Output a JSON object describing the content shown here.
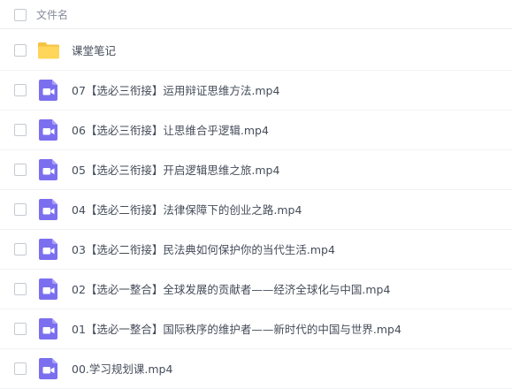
{
  "header": {
    "column_label": "文件名"
  },
  "files": [
    {
      "name": "课堂笔记",
      "type": "folder",
      "icon": "folder-icon"
    },
    {
      "name": "07【选必三衔接】运用辩证思维方法.mp4",
      "type": "video",
      "icon": "video-file-icon"
    },
    {
      "name": "06【选必三衔接】让思维合乎逻辑.mp4",
      "type": "video",
      "icon": "video-file-icon"
    },
    {
      "name": "05【选必三衔接】开启逻辑思维之旅.mp4",
      "type": "video",
      "icon": "video-file-icon"
    },
    {
      "name": "04【选必二衔接】法律保障下的创业之路.mp4",
      "type": "video",
      "icon": "video-file-icon"
    },
    {
      "name": "03【选必二衔接】民法典如何保护你的当代生活.mp4",
      "type": "video",
      "icon": "video-file-icon"
    },
    {
      "name": "02【选必一整合】全球发展的贡献者——经济全球化与中国.mp4",
      "type": "video",
      "icon": "video-file-icon"
    },
    {
      "name": "01【选必一整合】国际秩序的维护者——新时代的中国与世界.mp4",
      "type": "video",
      "icon": "video-file-icon"
    },
    {
      "name": "00.学习规划课.mp4",
      "type": "video",
      "icon": "video-file-icon"
    }
  ],
  "colors": {
    "folder": "#ffd659",
    "folder_tab": "#f5c242",
    "video": "#7b6ff0",
    "checkbox_border": "#c5c9d1",
    "text": "#454d5a",
    "header_text": "#878c9c"
  }
}
